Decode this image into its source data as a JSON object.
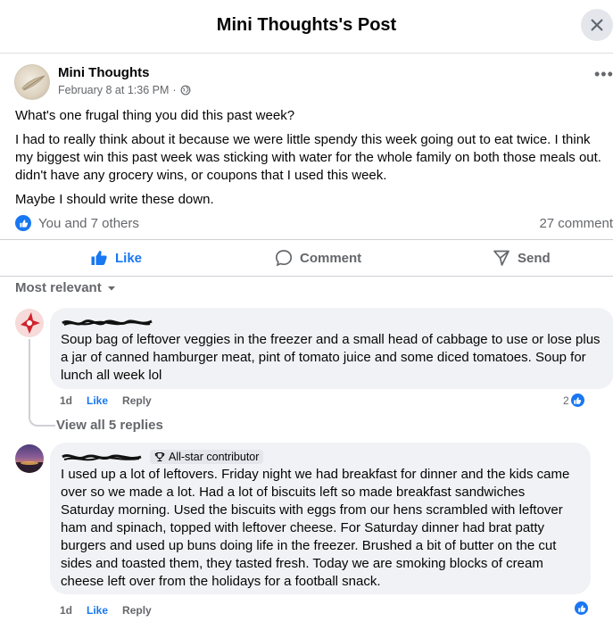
{
  "header": {
    "title": "Mini Thoughts's Post",
    "close_icon": "close-icon"
  },
  "post": {
    "author": "Mini Thoughts",
    "date": "February 8 at 1:36 PM",
    "separator": "·",
    "audience_icon": "globe-icon",
    "more_icon": "ellipsis-icon",
    "more_glyph": "•••",
    "paragraphs": [
      "What's one frugal thing you did this past week?",
      "I had to really think about it because we were little spendy this week going out to eat twice.  I think my biggest win this past week was sticking with water for the whole family on both those meals out. didn't have any grocery wins, or coupons that I used this week.",
      "Maybe I should write these down."
    ],
    "reactions_text": "You and 7 others",
    "comment_count": "27 comment"
  },
  "actions": {
    "like": "Like",
    "comment": "Comment",
    "send": "Send"
  },
  "sort_label": "Most relevant",
  "comments": [
    {
      "author_redacted": true,
      "text": "Soup bag of leftover veggies in the freezer and a small head of cabbage to use or lose plus a jar of canned hamburger meat, pint of tomato juice and some diced tomatoes. Soup for lunch all week lol",
      "time": "1d",
      "like": "Like",
      "reply": "Reply",
      "reaction_count": "2"
    },
    {
      "author_redacted": true,
      "badge": "All-star contributor",
      "text": "I used up a lot of leftovers. Friday night we had breakfast for dinner and the kids came over so we made a lot. Had a lot of biscuits left so made breakfast sandwiches Saturday morning. Used the biscuits with eggs from our hens scrambled with leftover ham and spinach, topped with leftover cheese. For Saturday dinner had brat patty burgers and used up buns doing life in the freezer. Brushed a bit of butter on the cut sides and toasted them, they tasted fresh. Today we are smoking blocks of cream cheese left over from the holidays for a football snack.",
      "time": "1d",
      "like": "Like",
      "reply": "Reply"
    }
  ],
  "view_replies": "View all 5 replies",
  "colors": {
    "accent": "#1877f2",
    "muted": "#65676b",
    "bubble": "#f0f2f5"
  }
}
